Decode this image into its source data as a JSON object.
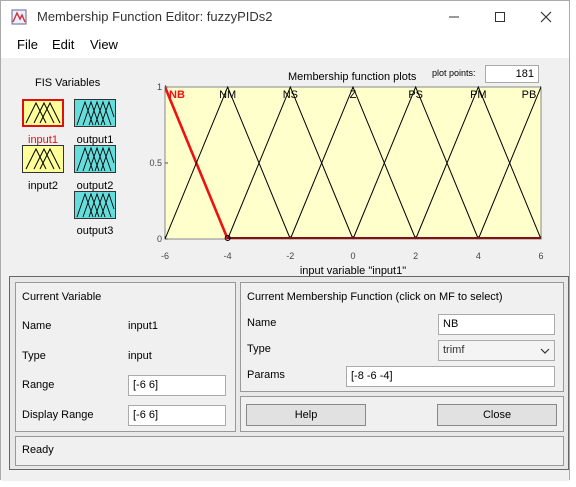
{
  "window": {
    "title": "Membership Function Editor: fuzzyPIDs2"
  },
  "menu": {
    "file": "File",
    "edit": "Edit",
    "view": "View"
  },
  "fis": {
    "title": "FIS Variables",
    "inputs": [
      "input1",
      "input2"
    ],
    "outputs": [
      "output1",
      "output2",
      "output3"
    ],
    "selected": "input1",
    "selected_color": "#e01010"
  },
  "plot": {
    "title": "Membership function plots",
    "plot_points_label": "plot points:",
    "plot_points": "181",
    "xlabel": "input variable \"input1\"",
    "bg_color": "#ffffcc",
    "selected_color": "#ee1111"
  },
  "chart_data": {
    "type": "line",
    "title": "Membership function plots",
    "xlabel": "input variable \"input1\"",
    "ylabel": "",
    "xlim": [
      -6,
      6
    ],
    "ylim": [
      0,
      1
    ],
    "xticks": [
      "-6",
      "-4",
      "-2",
      "0",
      "2",
      "4",
      "6"
    ],
    "yticks": [
      "0",
      "0.5",
      "1"
    ],
    "series": [
      {
        "name": "NB",
        "points": [
          [
            -8,
            0
          ],
          [
            -6,
            1
          ],
          [
            -4,
            0
          ]
        ],
        "selected": true
      },
      {
        "name": "NM",
        "points": [
          [
            -6,
            0
          ],
          [
            -4,
            1
          ],
          [
            -2,
            0
          ]
        ]
      },
      {
        "name": "NS",
        "points": [
          [
            -4,
            0
          ],
          [
            -2,
            1
          ],
          [
            0,
            0
          ]
        ]
      },
      {
        "name": "Z",
        "points": [
          [
            -2,
            0
          ],
          [
            0,
            1
          ],
          [
            2,
            0
          ]
        ]
      },
      {
        "name": "PS",
        "points": [
          [
            0,
            0
          ],
          [
            2,
            1
          ],
          [
            4,
            0
          ]
        ]
      },
      {
        "name": "PM",
        "points": [
          [
            2,
            0
          ],
          [
            4,
            1
          ],
          [
            6,
            0
          ]
        ]
      },
      {
        "name": "PB",
        "points": [
          [
            4,
            0
          ],
          [
            6,
            1
          ],
          [
            8,
            0
          ]
        ]
      }
    ]
  },
  "current_variable": {
    "title": "Current Variable",
    "name_label": "Name",
    "name_value": "input1",
    "type_label": "Type",
    "type_value": "input",
    "range_label": "Range",
    "range_value": "[-6 6]",
    "display_range_label": "Display Range",
    "display_range_value": "[-6 6]"
  },
  "current_mf": {
    "title": "Current Membership Function (click on MF to select)",
    "name_label": "Name",
    "name_value": "NB",
    "type_label": "Type",
    "type_value": "trimf",
    "params_label": "Params",
    "params_value": "[-8 -6 -4]"
  },
  "buttons": {
    "help": "Help",
    "close": "Close"
  },
  "status": "Ready"
}
